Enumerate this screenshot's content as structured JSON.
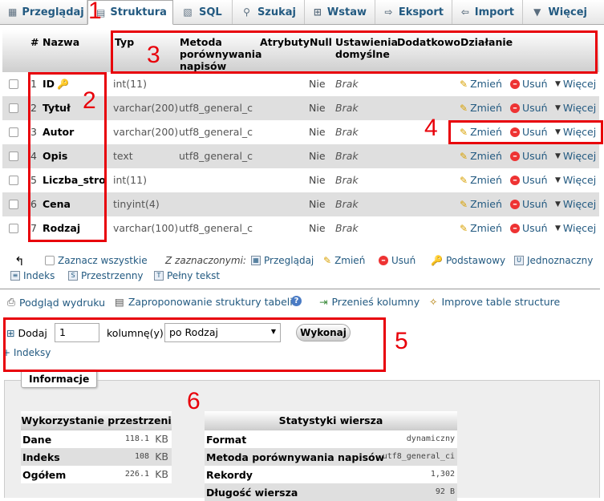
{
  "tabs": [
    {
      "label": "Przeglądaj",
      "icon": "table-icon"
    },
    {
      "label": "Struktura",
      "icon": "structure-icon"
    },
    {
      "label": "SQL",
      "icon": "sql-icon"
    },
    {
      "label": "Szukaj",
      "icon": "search-icon"
    },
    {
      "label": "Wstaw",
      "icon": "insert-icon"
    },
    {
      "label": "Eksport",
      "icon": "export-icon"
    },
    {
      "label": "Import",
      "icon": "import-icon"
    },
    {
      "label": "Więcej",
      "icon": "chevron-down-icon"
    }
  ],
  "table": {
    "headers": {
      "num": "#",
      "name": "Nazwa",
      "type": "Typ",
      "collation": "Metoda porównywania napisów",
      "attributes": "Atrybuty",
      "null": "Null",
      "default": "Ustawienia domyślne",
      "extra": "Dodatkowo",
      "action": "Działanie"
    },
    "rows": [
      {
        "num": "1",
        "name": "ID",
        "type": "int(11)",
        "collation": "",
        "null": "Nie",
        "default": "Brak"
      },
      {
        "num": "2",
        "name": "Tytuł",
        "type": "varchar(200)",
        "collation": "utf8_general_ci",
        "null": "Nie",
        "default": "Brak"
      },
      {
        "num": "3",
        "name": "Autor",
        "type": "varchar(200)",
        "collation": "utf8_general_ci",
        "null": "Nie",
        "default": "Brak"
      },
      {
        "num": "4",
        "name": "Opis",
        "type": "text",
        "collation": "utf8_general_ci",
        "null": "Nie",
        "default": "Brak"
      },
      {
        "num": "5",
        "name": "Liczba_stron",
        "type": "int(11)",
        "collation": "",
        "null": "Nie",
        "default": "Brak"
      },
      {
        "num": "6",
        "name": "Cena",
        "type": "tinyint(4)",
        "collation": "",
        "null": "Nie",
        "default": "Brak"
      },
      {
        "num": "7",
        "name": "Rodzaj",
        "type": "varchar(100)",
        "collation": "utf8_general_ci",
        "null": "Nie",
        "default": "Brak"
      }
    ],
    "actions": {
      "change": "Zmień",
      "drop": "Usuń",
      "more": "Więcej"
    }
  },
  "bulk": {
    "check_all": "Zaznacz wszystkie",
    "with_selected": "Z zaznaczonymi:",
    "browse": "Przeglądaj",
    "change": "Zmień",
    "drop": "Usuń",
    "primary": "Podstawowy",
    "unique": "Jednoznaczny",
    "index": "Indeks",
    "spatial": "Przestrzenny",
    "fulltext": "Pełny tekst"
  },
  "links": {
    "print": "Podgląd wydruku",
    "propose": "Zaproponowanie struktury tabeli",
    "move": "Przenieś kolumny",
    "improve": "Improve table structure"
  },
  "add_columns": {
    "label": "Dodaj",
    "count": "1",
    "suffix": "kolumnę(y)",
    "position": "po Rodzaj",
    "button": "Wykonaj",
    "indexes": "+ Indeksy"
  },
  "info": {
    "legend": "Informacje",
    "space": {
      "title": "Wykorzystanie przestrzeni",
      "rows": [
        {
          "label": "Dane",
          "value": "118.1",
          "unit": "KB"
        },
        {
          "label": "Indeks",
          "value": "108",
          "unit": "KB"
        },
        {
          "label": "Ogółem",
          "value": "226.1",
          "unit": "KB"
        }
      ]
    },
    "stats": {
      "title": "Statystyki wiersza",
      "rows": [
        {
          "label": "Format",
          "value": "dynamiczny"
        },
        {
          "label": "Metoda porównywania napisów",
          "value": "utf8_general_ci"
        },
        {
          "label": "Rekordy",
          "value": "1,302"
        },
        {
          "label": "Długość wiersza",
          "value": "92 B"
        }
      ]
    }
  },
  "annotations": {
    "n1": "1",
    "n2": "2",
    "n3": "3",
    "n4": "4",
    "n5": "5",
    "n6": "6",
    "color": "#e8000a"
  }
}
